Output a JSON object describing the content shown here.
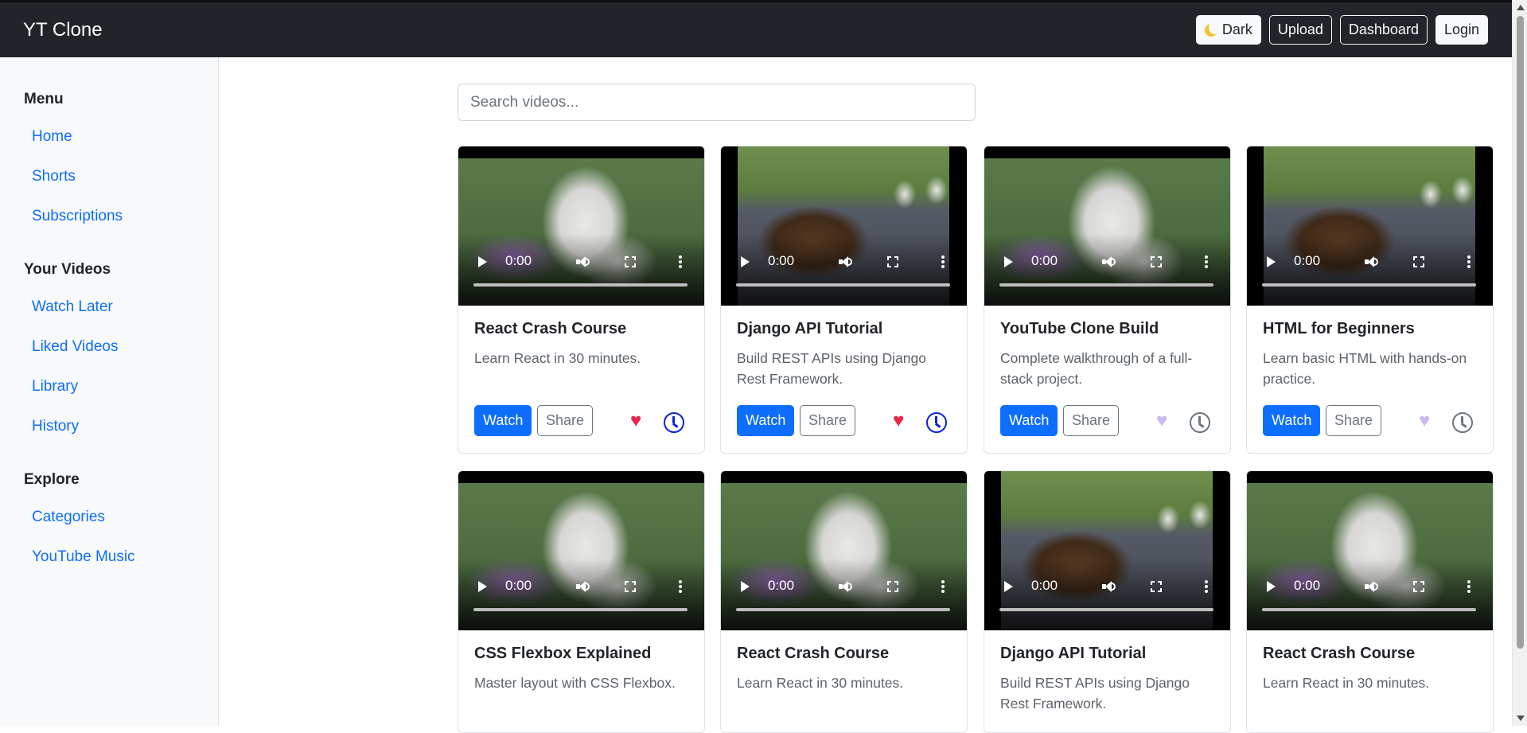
{
  "app": {
    "brand": "YT Clone"
  },
  "nav": {
    "dark_label": "Dark",
    "upload_label": "Upload",
    "dashboard_label": "Dashboard",
    "login_label": "Login"
  },
  "sidebar": {
    "sections": [
      {
        "title": "Menu",
        "items": [
          "Home",
          "Shorts",
          "Subscriptions"
        ]
      },
      {
        "title": "Your Videos",
        "items": [
          "Watch Later",
          "Liked Videos",
          "Library",
          "History"
        ]
      },
      {
        "title": "Explore",
        "items": [
          "Categories",
          "YouTube Music"
        ]
      }
    ]
  },
  "search": {
    "placeholder": "Search videos..."
  },
  "player": {
    "time": "0:00"
  },
  "actions": {
    "watch_label": "Watch",
    "share_label": "Share"
  },
  "colors": {
    "liked_heart": "#e8254a",
    "unliked_heart": "#c9b8f0",
    "watch_later_active": "#0b22d6",
    "watch_later_inactive": "#6c757d"
  },
  "videos": [
    {
      "title": "React Crash Course",
      "description": "Learn React in 30 minutes.",
      "thumbnail": "wolf",
      "liked": true,
      "watch_later": true
    },
    {
      "title": "Django API Tutorial",
      "description": "Build REST APIs using Django Rest Framework.",
      "thumbnail": "bear",
      "liked": true,
      "watch_later": true
    },
    {
      "title": "YouTube Clone Build",
      "description": "Complete walkthrough of a full-stack project.",
      "thumbnail": "wolf",
      "liked": false,
      "watch_later": false
    },
    {
      "title": "HTML for Beginners",
      "description": "Learn basic HTML with hands-on practice.",
      "thumbnail": "bear",
      "liked": false,
      "watch_later": false
    },
    {
      "title": "CSS Flexbox Explained",
      "description": "Master layout with CSS Flexbox.",
      "thumbnail": "wolf"
    },
    {
      "title": "React Crash Course",
      "description": "Learn React in 30 minutes.",
      "thumbnail": "wolf"
    },
    {
      "title": "Django API Tutorial",
      "description": "Build REST APIs using Django Rest Framework.",
      "thumbnail": "bear"
    },
    {
      "title": "React Crash Course",
      "description": "Learn React in 30 minutes.",
      "thumbnail": "wolf"
    }
  ]
}
